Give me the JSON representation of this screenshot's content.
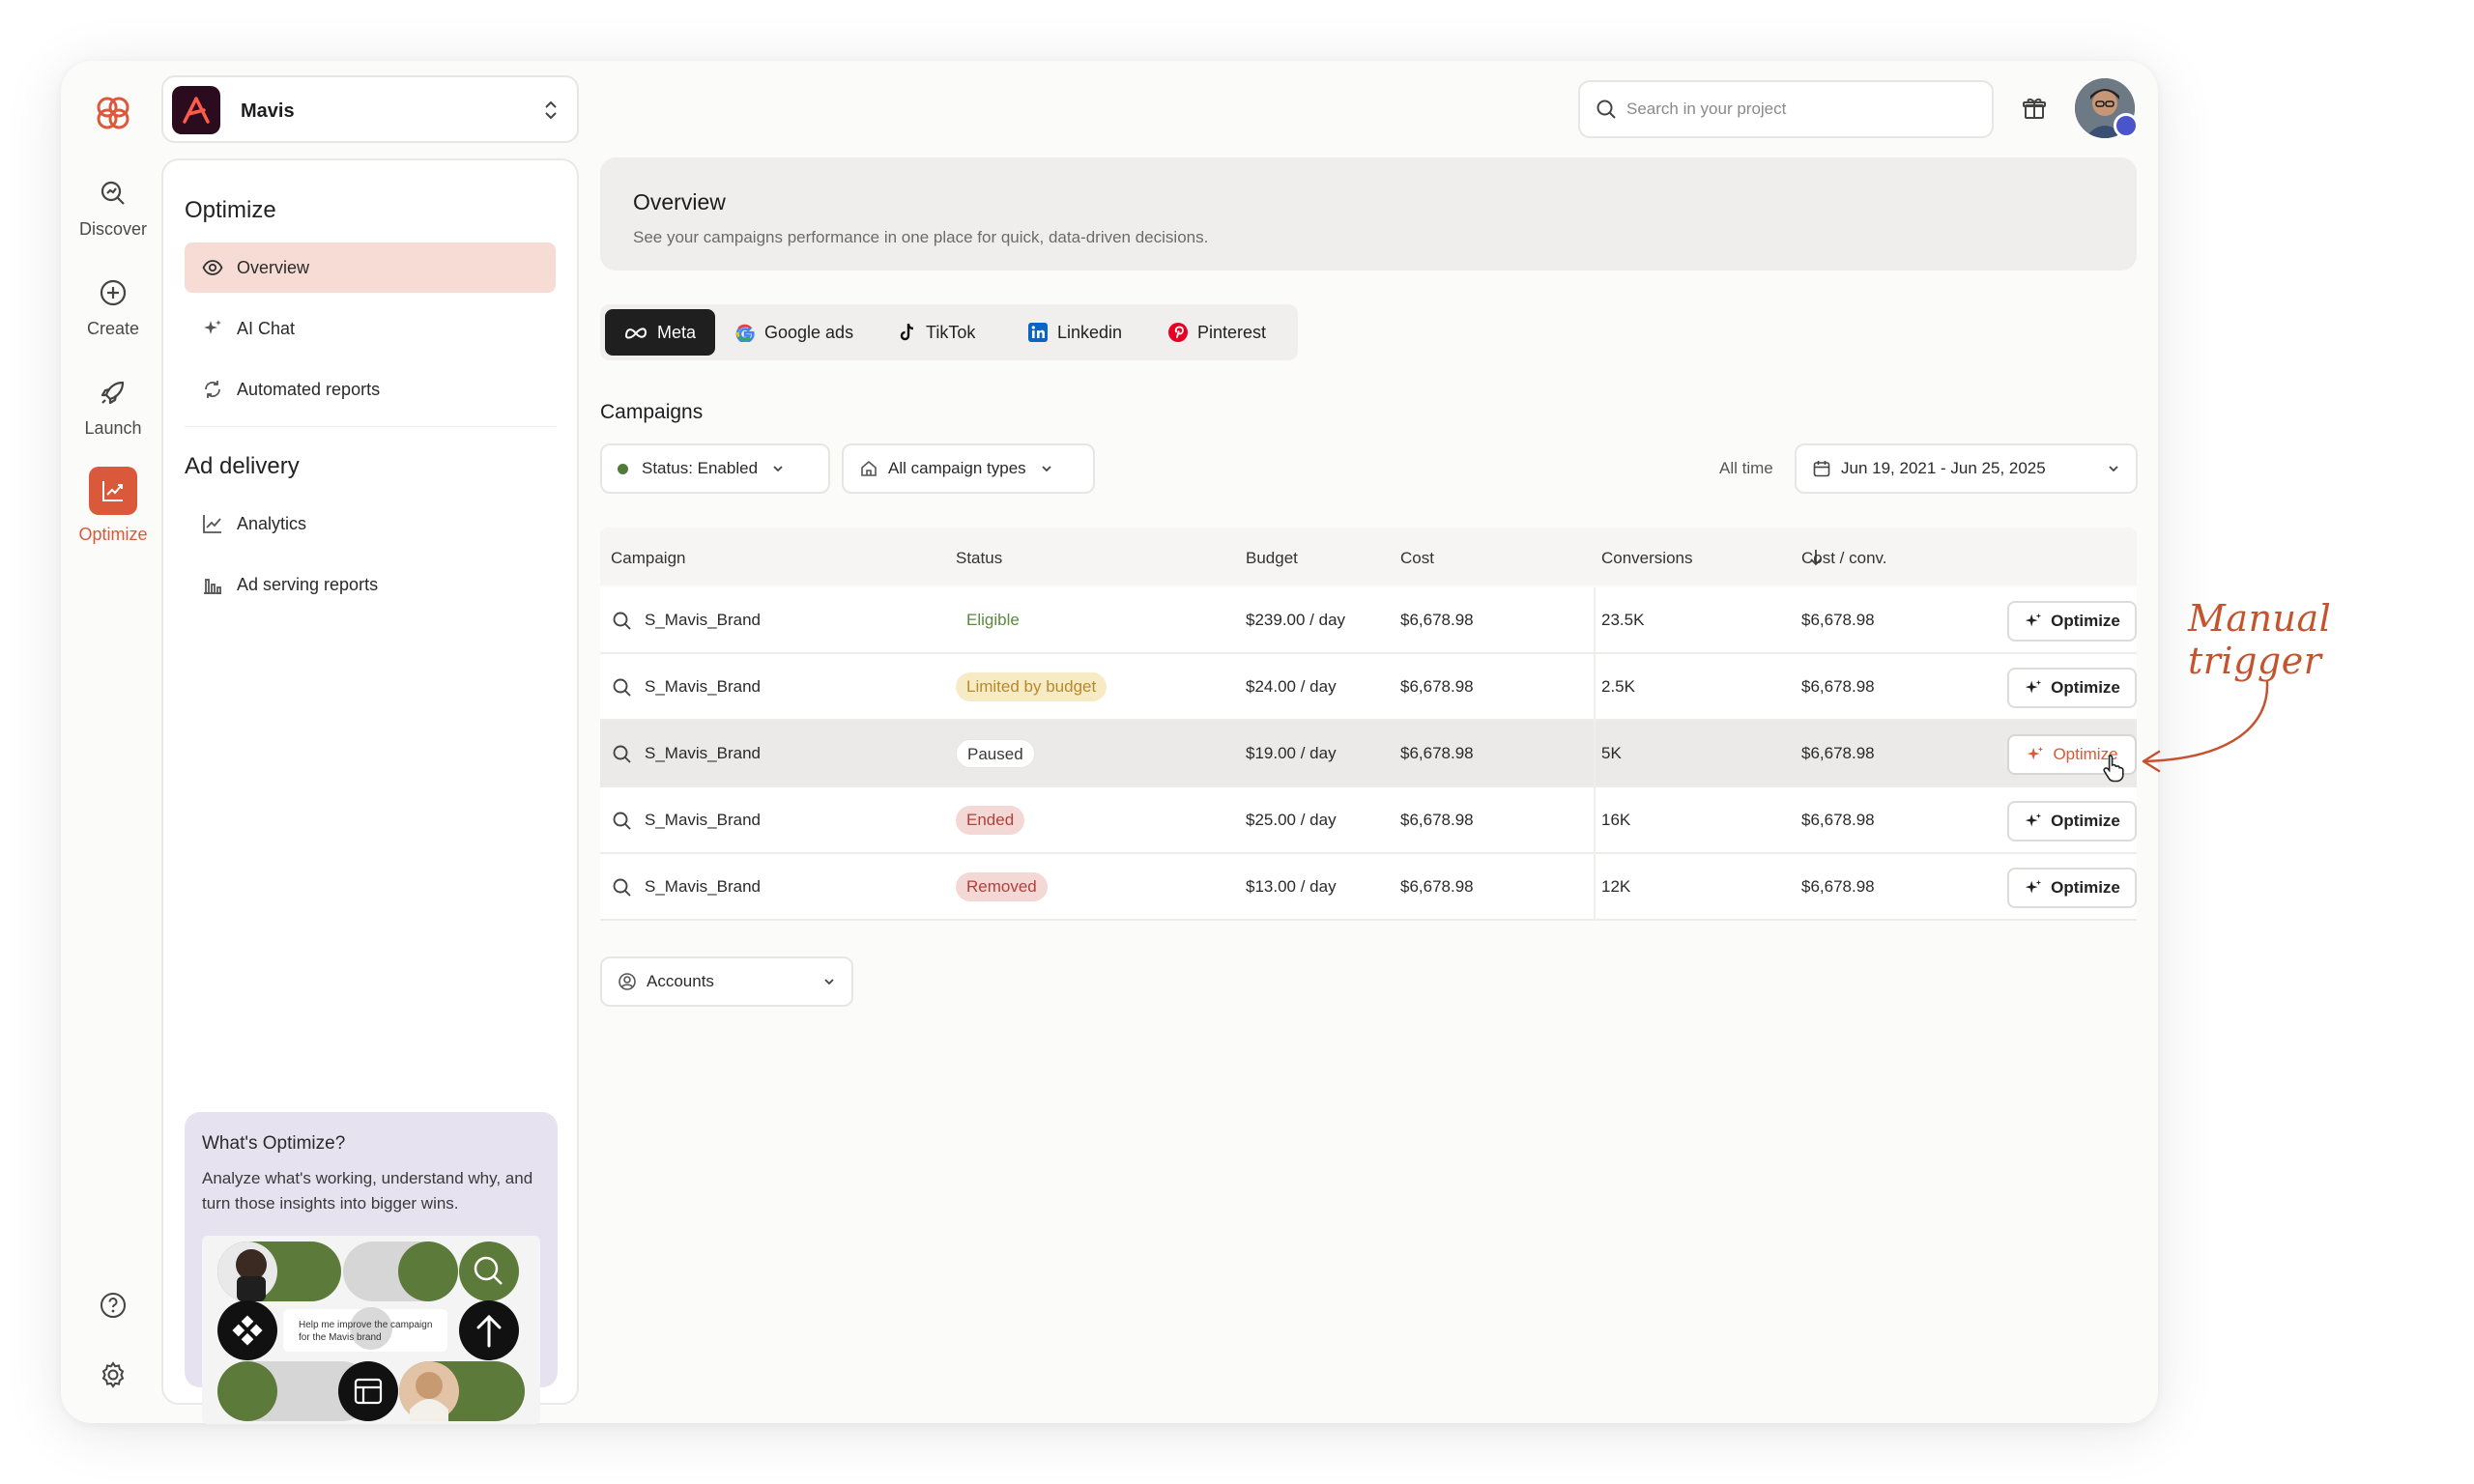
{
  "app": {
    "project_name": "Mavis"
  },
  "rail": {
    "items": [
      {
        "label": "Discover",
        "icon": "discover-icon"
      },
      {
        "label": "Create",
        "icon": "plus-circle-icon"
      },
      {
        "label": "Launch",
        "icon": "rocket-icon"
      },
      {
        "label": "Optimize",
        "icon": "optimize-chart-icon",
        "active": true
      }
    ],
    "bottom_icons": [
      "help-icon",
      "settings-icon"
    ]
  },
  "sidebar": {
    "optimize_title": "Optimize",
    "optimize_items": [
      {
        "label": "Overview",
        "icon": "eye-icon",
        "active": true
      },
      {
        "label": "AI Chat",
        "icon": "sparkle-icon"
      },
      {
        "label": "Automated reports",
        "icon": "automation-icon"
      }
    ],
    "delivery_title": "Ad delivery",
    "delivery_items": [
      {
        "label": "Analytics",
        "icon": "line-chart-icon"
      },
      {
        "label": "Ad serving reports",
        "icon": "bar-chart-icon"
      }
    ],
    "promo": {
      "title": "What's Optimize?",
      "description": "Analyze what's working, understand why, and turn those insights into bigger wins.",
      "chat_text": "Help me improve the campaign for the Mavis brand"
    }
  },
  "header": {
    "search_placeholder": "Search in your project"
  },
  "overview": {
    "title": "Overview",
    "subtitle": "See your campaigns performance in one place for quick, data-driven decisions."
  },
  "platform_tabs": [
    {
      "label": "Meta",
      "icon": "meta-icon",
      "active": true
    },
    {
      "label": "Google ads",
      "icon": "google-icon"
    },
    {
      "label": "TikTok",
      "icon": "tiktok-icon"
    },
    {
      "label": "Linkedin",
      "icon": "linkedin-icon"
    },
    {
      "label": "Pinterest",
      "icon": "pinterest-icon"
    }
  ],
  "campaigns": {
    "title": "Campaigns",
    "filters": {
      "status": "Status: Enabled",
      "types": "All campaign types",
      "time_label": "All time",
      "date_range": "Jun 19, 2021 - Jun 25, 2025"
    },
    "columns": [
      "Campaign",
      "Status",
      "Budget",
      "Cost",
      "Conversions",
      "Cost / conv."
    ],
    "sort": {
      "column": "Conversions",
      "direction": "descending"
    },
    "rows": [
      {
        "name": "S_Mavis_Brand",
        "status": "Eligible",
        "budget": "$239.00 / day",
        "cost": "$6,678.98",
        "conversions": "23.5K",
        "cost_per_conv": "$6,678.98",
        "action": "Optimize"
      },
      {
        "name": "S_Mavis_Brand",
        "status": "Limited by budget",
        "budget": "$24.00 / day",
        "cost": "$6,678.98",
        "conversions": "2.5K",
        "cost_per_conv": "$6,678.98",
        "action": "Optimize"
      },
      {
        "name": "S_Mavis_Brand",
        "status": "Paused",
        "budget": "$19.00 / day",
        "cost": "$6,678.98",
        "conversions": "5K",
        "cost_per_conv": "$6,678.98",
        "action": "Optimize",
        "hovered": true
      },
      {
        "name": "S_Mavis_Brand",
        "status": "Ended",
        "budget": "$25.00 / day",
        "cost": "$6,678.98",
        "conversions": "16K",
        "cost_per_conv": "$6,678.98",
        "action": "Optimize"
      },
      {
        "name": "S_Mavis_Brand",
        "status": "Removed",
        "budget": "$13.00 / day",
        "cost": "$6,678.98",
        "conversions": "12K",
        "cost_per_conv": "$6,678.98",
        "action": "Optimize"
      }
    ],
    "accounts_label": "Accounts"
  },
  "status_colors": {
    "Eligible": {
      "fg": "#5a8a3c",
      "bg": "transparent"
    },
    "Limited by budget": {
      "fg": "#b8892a",
      "bg": "#f7ebc6"
    },
    "Paused": {
      "fg": "#3a3a3a",
      "bg": "#ffffff"
    },
    "Ended": {
      "fg": "#b0413a",
      "bg": "#f4d8d6"
    },
    "Removed": {
      "fg": "#b0413a",
      "bg": "#f4d8d6"
    }
  },
  "annotation": {
    "text": "Manual trigger",
    "color": "#c4542f"
  },
  "colors": {
    "accent": "#d9593a",
    "active_nav_bg": "#f6dcd4"
  }
}
